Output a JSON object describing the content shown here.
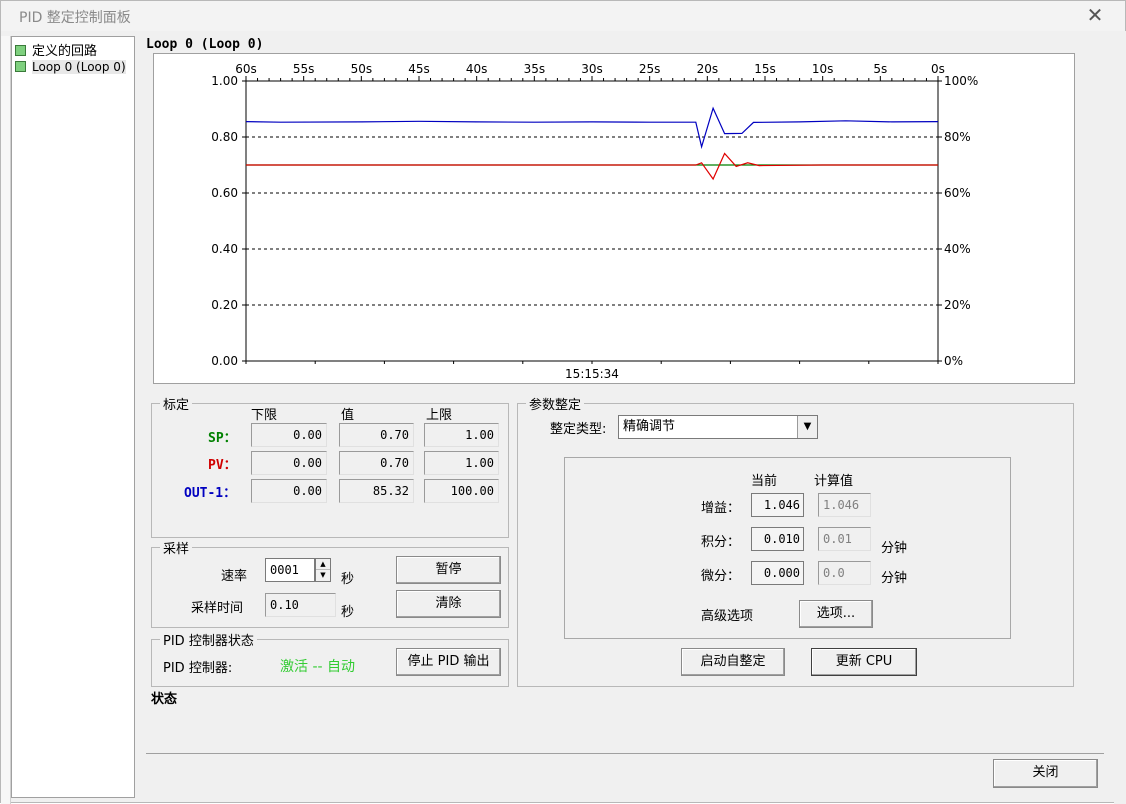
{
  "window": {
    "title": "PID 整定控制面板",
    "close_glyph": "✕"
  },
  "tree": {
    "root_label": "定义的回路",
    "items": [
      {
        "label": "Loop 0 (Loop 0)"
      }
    ]
  },
  "chart_header": "Loop 0 (Loop 0)",
  "chart_data": {
    "type": "line",
    "x_labels": [
      "60s",
      "55s",
      "50s",
      "45s",
      "40s",
      "35s",
      "30s",
      "25s",
      "20s",
      "15s",
      "10s",
      "5s",
      "0s"
    ],
    "y_left_labels": [
      "1.00",
      "0.80",
      "0.60",
      "0.40",
      "0.20",
      "0.00"
    ],
    "y_right_labels": [
      "100%",
      "80%",
      "60%",
      "40%",
      "20%",
      "0%"
    ],
    "y_left_range": [
      0,
      1
    ],
    "y_right_range": [
      0,
      100
    ],
    "x_range_seconds_ago": [
      60,
      0
    ],
    "time_label": "15:15:34",
    "grid": "dashed horizontal",
    "series": [
      {
        "key": "OUT-1",
        "color": "#0000c0",
        "axis": "right",
        "points": [
          [
            60,
            85.5
          ],
          [
            57,
            85.3
          ],
          [
            50,
            85.4
          ],
          [
            45,
            85.6
          ],
          [
            40,
            85.4
          ],
          [
            35,
            85.3
          ],
          [
            30,
            85.4
          ],
          [
            25,
            85.3
          ],
          [
            21,
            85.3
          ],
          [
            20.5,
            76.5
          ],
          [
            19.5,
            90.3
          ],
          [
            18.5,
            81.2
          ],
          [
            17,
            81.3
          ],
          [
            16,
            85.2
          ],
          [
            12,
            85.4
          ],
          [
            8,
            85.8
          ],
          [
            4,
            85.4
          ],
          [
            0,
            85.5
          ]
        ]
      },
      {
        "key": "PV",
        "color": "#e00000",
        "axis": "left",
        "points": [
          [
            60,
            0.7
          ],
          [
            40,
            0.7
          ],
          [
            21,
            0.7
          ],
          [
            20.5,
            0.708
          ],
          [
            19.5,
            0.65
          ],
          [
            18.5,
            0.741
          ],
          [
            17.5,
            0.695
          ],
          [
            16.5,
            0.708
          ],
          [
            15.5,
            0.698
          ],
          [
            10,
            0.7
          ],
          [
            0,
            0.7
          ]
        ]
      },
      {
        "key": "SP",
        "color": "#008000",
        "axis": "left",
        "points": [
          [
            60,
            0.7
          ],
          [
            0,
            0.7
          ]
        ]
      }
    ]
  },
  "calibration": {
    "title": "标定",
    "col_low": "下限",
    "col_value": "值",
    "col_high": "上限",
    "rows": [
      {
        "name": "SP：",
        "color": "#008000",
        "low": "0.00",
        "value": "0.70",
        "high": "1.00"
      },
      {
        "name": "PV：",
        "color": "#d00000",
        "low": "0.00",
        "value": "0.70",
        "high": "1.00"
      },
      {
        "name": "OUT-1：",
        "color": "#0000c0",
        "low": "0.00",
        "value": "85.32",
        "high": "100.00"
      }
    ]
  },
  "sampling": {
    "title": "采样",
    "rate_label": "速率",
    "rate_value": "0001",
    "rate_unit": "秒",
    "time_label": "采样时间",
    "time_value": "0.10",
    "time_unit": "秒",
    "pause_btn": "暂停",
    "clear_btn": "清除"
  },
  "pid_status": {
    "title": "PID 控制器状态",
    "controller_label": "PID 控制器:",
    "state_text": "激活 -- 自动",
    "state_color": "#33cc33",
    "stop_btn": "停止 PID 输出"
  },
  "tuning": {
    "title": "参数整定",
    "type_label": "整定类型:",
    "type_value": "精确调节",
    "col_current": "当前",
    "col_calc": "计算值",
    "gain_label": "增益：",
    "gain_cur": "1.046",
    "gain_calc": "1.046",
    "integral_label": "积分：",
    "integral_cur": "0.010",
    "integral_calc": "0.01",
    "integral_unit": "分钟",
    "deriv_label": "微分：",
    "deriv_cur": "0.000",
    "deriv_calc": "0.0",
    "deriv_unit": "分钟",
    "advanced_label": "高级选项",
    "options_btn": "选项...",
    "autotune_btn": "启动自整定",
    "update_btn": "更新 CPU"
  },
  "status_label": "状态",
  "close_btn": "关闭"
}
